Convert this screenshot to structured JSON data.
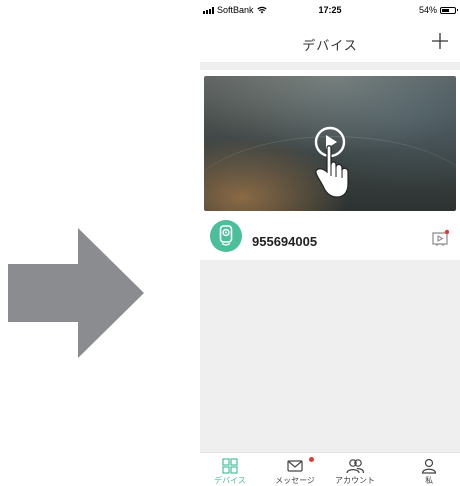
{
  "colors": {
    "accent": "#4bbf9a",
    "badge": "#e53935",
    "arrow": "#8b8c8f"
  },
  "status_bar": {
    "carrier": "SoftBank",
    "time": "17:25",
    "battery": "54%"
  },
  "header": {
    "title": "デバイス",
    "add_icon": "plus-icon"
  },
  "device": {
    "id": "955694005",
    "play_icon": "play-icon",
    "icon": "camera-icon"
  },
  "tabs": [
    {
      "label": "デバイス",
      "icon": "grid-icon",
      "active": true
    },
    {
      "label": "メッセージ",
      "icon": "mail-icon",
      "badge": true
    },
    {
      "label": "アカウント",
      "icon": "users-icon"
    },
    {
      "label": "私",
      "icon": "person-icon"
    }
  ]
}
